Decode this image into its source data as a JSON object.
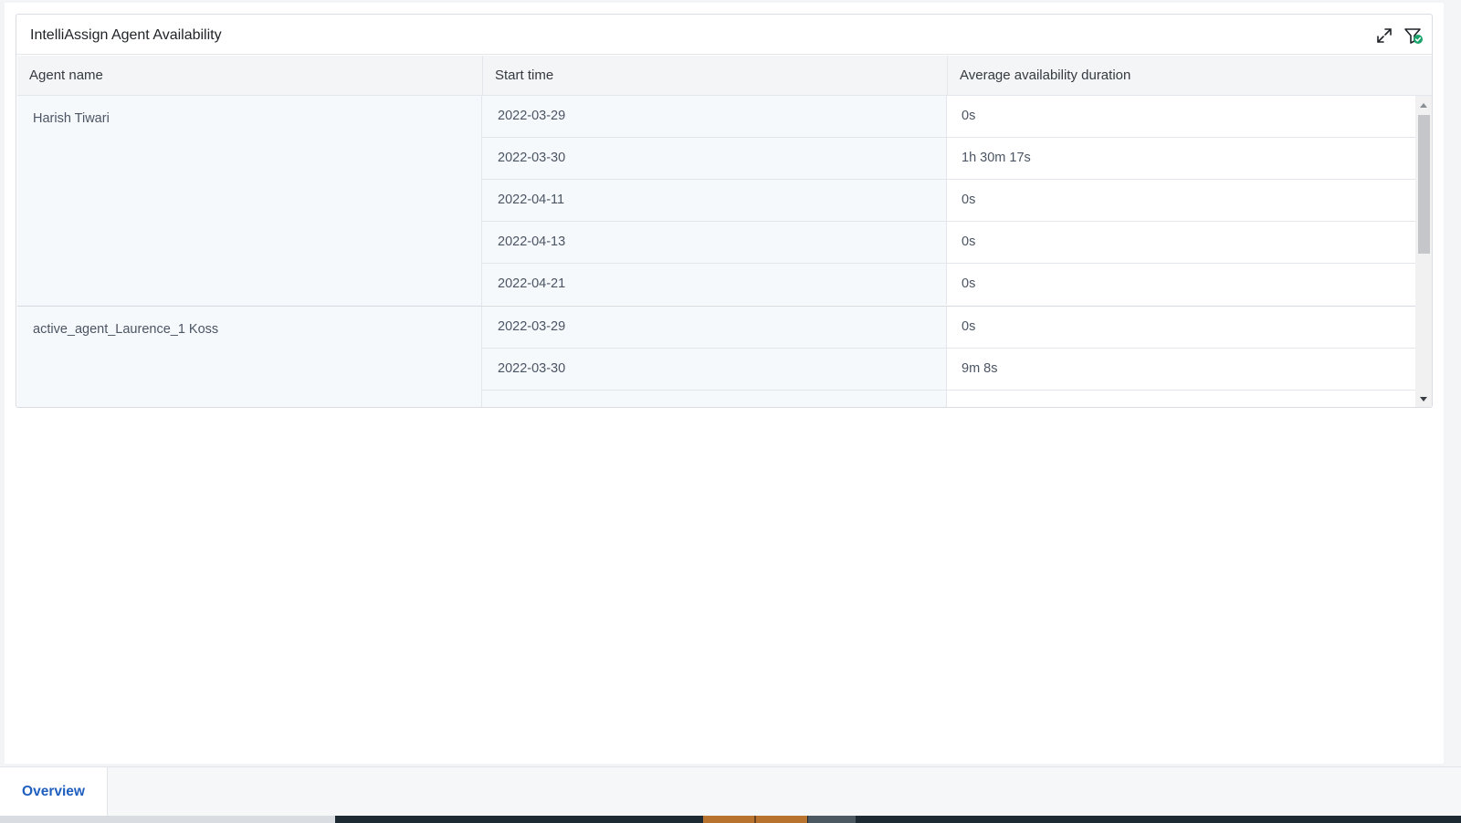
{
  "widget": {
    "title": "IntelliAssign Agent Availability",
    "actions": [
      "expand-icon",
      "filter-applied-icon"
    ]
  },
  "table": {
    "columns": [
      "Agent name",
      "Start time",
      "Average availability duration"
    ],
    "groups": [
      {
        "agent": "Harish Tiwari",
        "rows": [
          {
            "start": "2022-03-29",
            "duration": "0s"
          },
          {
            "start": "2022-03-30",
            "duration": "1h 30m 17s"
          },
          {
            "start": "2022-04-11",
            "duration": "0s"
          },
          {
            "start": "2022-04-13",
            "duration": "0s"
          },
          {
            "start": "2022-04-21",
            "duration": "0s"
          }
        ]
      },
      {
        "agent": "active_agent_Laurence_1 Koss",
        "rows": [
          {
            "start": "2022-03-29",
            "duration": "0s"
          },
          {
            "start": "2022-03-30",
            "duration": "9m 8s"
          },
          {
            "start": "",
            "duration": ""
          }
        ]
      }
    ]
  },
  "tabs": [
    {
      "label": "Overview",
      "active": true
    }
  ],
  "colors": {
    "accent": "#1f5fbf",
    "filter_badge": "#1aa36b",
    "row_tint": "#f6f9fc"
  }
}
